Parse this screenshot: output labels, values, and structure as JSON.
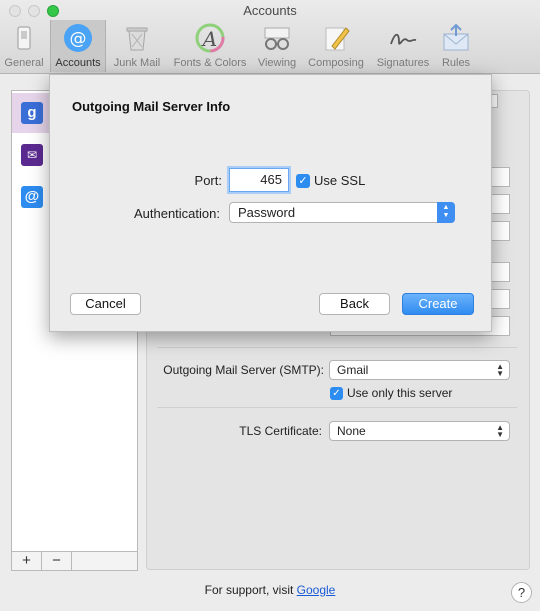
{
  "window": {
    "title": "Accounts"
  },
  "toolbar": {
    "items": [
      {
        "label": "General",
        "icon": "switch-icon"
      },
      {
        "label": "Accounts",
        "icon": "at-icon"
      },
      {
        "label": "Junk Mail",
        "icon": "trash-icon"
      },
      {
        "label": "Fonts & Colors",
        "icon": "font-icon"
      },
      {
        "label": "Viewing",
        "icon": "glasses-icon"
      },
      {
        "label": "Composing",
        "icon": "pencil-icon"
      },
      {
        "label": "Signatures",
        "icon": "signature-icon"
      },
      {
        "label": "Rules",
        "icon": "rules-icon"
      }
    ],
    "selected": "Accounts"
  },
  "accounts": [
    {
      "icon": "google-icon",
      "glyph": "g",
      "color": "#3a6fd8"
    },
    {
      "icon": "envelope-icon",
      "glyph": "✉",
      "color": "#5b2a91"
    },
    {
      "icon": "at-icon",
      "glyph": "@",
      "color": "#2d8cf0"
    }
  ],
  "sidebar_footer": {
    "add": "+",
    "remove": "−"
  },
  "settings": {
    "outgoing_label": "Outgoing Mail Server (SMTP):",
    "outgoing_value": "Gmail",
    "use_only_label": "Use only this server",
    "tls_label": "TLS Certificate:",
    "tls_value": "None"
  },
  "support": {
    "prefix": "For support, visit ",
    "link": "Google"
  },
  "help": "?",
  "sheet": {
    "title": "Outgoing Mail Server Info",
    "port_label": "Port:",
    "port_value": "465",
    "ssl_label": "Use SSL",
    "auth_label": "Authentication:",
    "auth_value": "Password",
    "cancel": "Cancel",
    "back": "Back",
    "create": "Create"
  },
  "colors": {
    "accent": "#2f8cf1",
    "selected_row": "#e6d5ea"
  }
}
